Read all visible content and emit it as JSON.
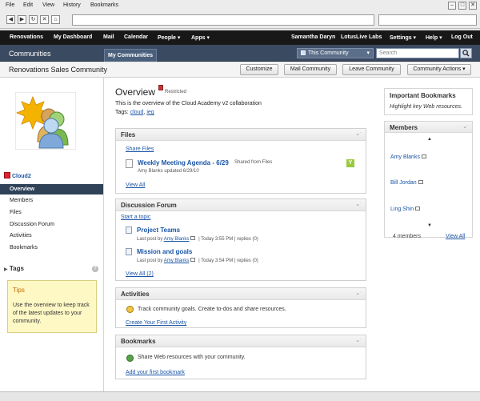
{
  "browser": {
    "menu": [
      "File",
      "Edit",
      "View",
      "History",
      "Bookmarks"
    ],
    "window_controls": [
      "–",
      "□",
      "✕"
    ],
    "nav_buttons": [
      "◀",
      "▶",
      "↻",
      "✕",
      "⌂"
    ]
  },
  "topnav": {
    "left": [
      "Renovations",
      "My Dashboard",
      "Mail",
      "Calendar",
      "People ▾",
      "Apps ▾"
    ],
    "right": [
      "Samantha Daryn",
      "LotusLive Labs",
      "Settings ▾",
      "Help ▾",
      "Log Out"
    ]
  },
  "communities_bar": {
    "title": "Communities",
    "tab": "My Communities",
    "scope": "This Community",
    "search_placeholder": "Search"
  },
  "community": {
    "title": "Renovations Sales Community",
    "actions": [
      "Customize",
      "Mail Community",
      "Leave Community",
      "Community Actions ▾"
    ],
    "name": "Cloud2"
  },
  "left_nav": [
    "Overview",
    "Members",
    "Files",
    "Discussion Forum",
    "Activities",
    "Bookmarks"
  ],
  "tags_header": "Tags",
  "tips": {
    "title": "Tips",
    "body": "Use the overview to keep track of the latest updates to your community."
  },
  "overview": {
    "title": "Overview",
    "badge": "Restricted",
    "description": "This is the overview of the Cloud Academy v2 collaboration",
    "tags_label": "Tags:",
    "tags": [
      "cloud",
      "ieg"
    ]
  },
  "files": {
    "title": "Files",
    "share_link": "Share Files",
    "item_title": "Weekly Meeting Agenda - 6/29",
    "item_meta": "Shared from Files",
    "item_sub": "Amy Blanks updated 6/29/10",
    "view_all": "View All"
  },
  "forum": {
    "title": "Discussion Forum",
    "start": "Start a topic",
    "topics": [
      {
        "title": "Project Teams",
        "by": "Last post by",
        "author": "Amy Blanks",
        "time": "| Today 3:55 PM",
        "replies": "| replies (0)"
      },
      {
        "title": "Mission and goals",
        "by": "Last post by",
        "author": "Amy Blanks",
        "time": "| Today 3:54 PM",
        "replies": "| replies (0)"
      }
    ],
    "view_all": "View All (2)"
  },
  "activities": {
    "title": "Activities",
    "desc": "Track community goals. Create to-dos and share resources.",
    "link": "Create Your First Activity"
  },
  "bookmarks": {
    "title": "Bookmarks",
    "desc": "Share Web resources with your community.",
    "link": "Add your first bookmark"
  },
  "important_bookmarks": {
    "title": "Important Bookmarks",
    "body": "Highlight key Web resources."
  },
  "members": {
    "title": "Members",
    "list": [
      "Amy Blanks",
      "Bill Jordan",
      "Ling Shin"
    ],
    "count": "4 members",
    "view_all": "View All"
  },
  "colors": {
    "topbar": "#181818",
    "commbar": "#3a4a60",
    "nav_selected": "#2f4257",
    "link": "#1a55a6",
    "tips_bg": "#fef8c5",
    "tips_title": "#c76a00"
  }
}
